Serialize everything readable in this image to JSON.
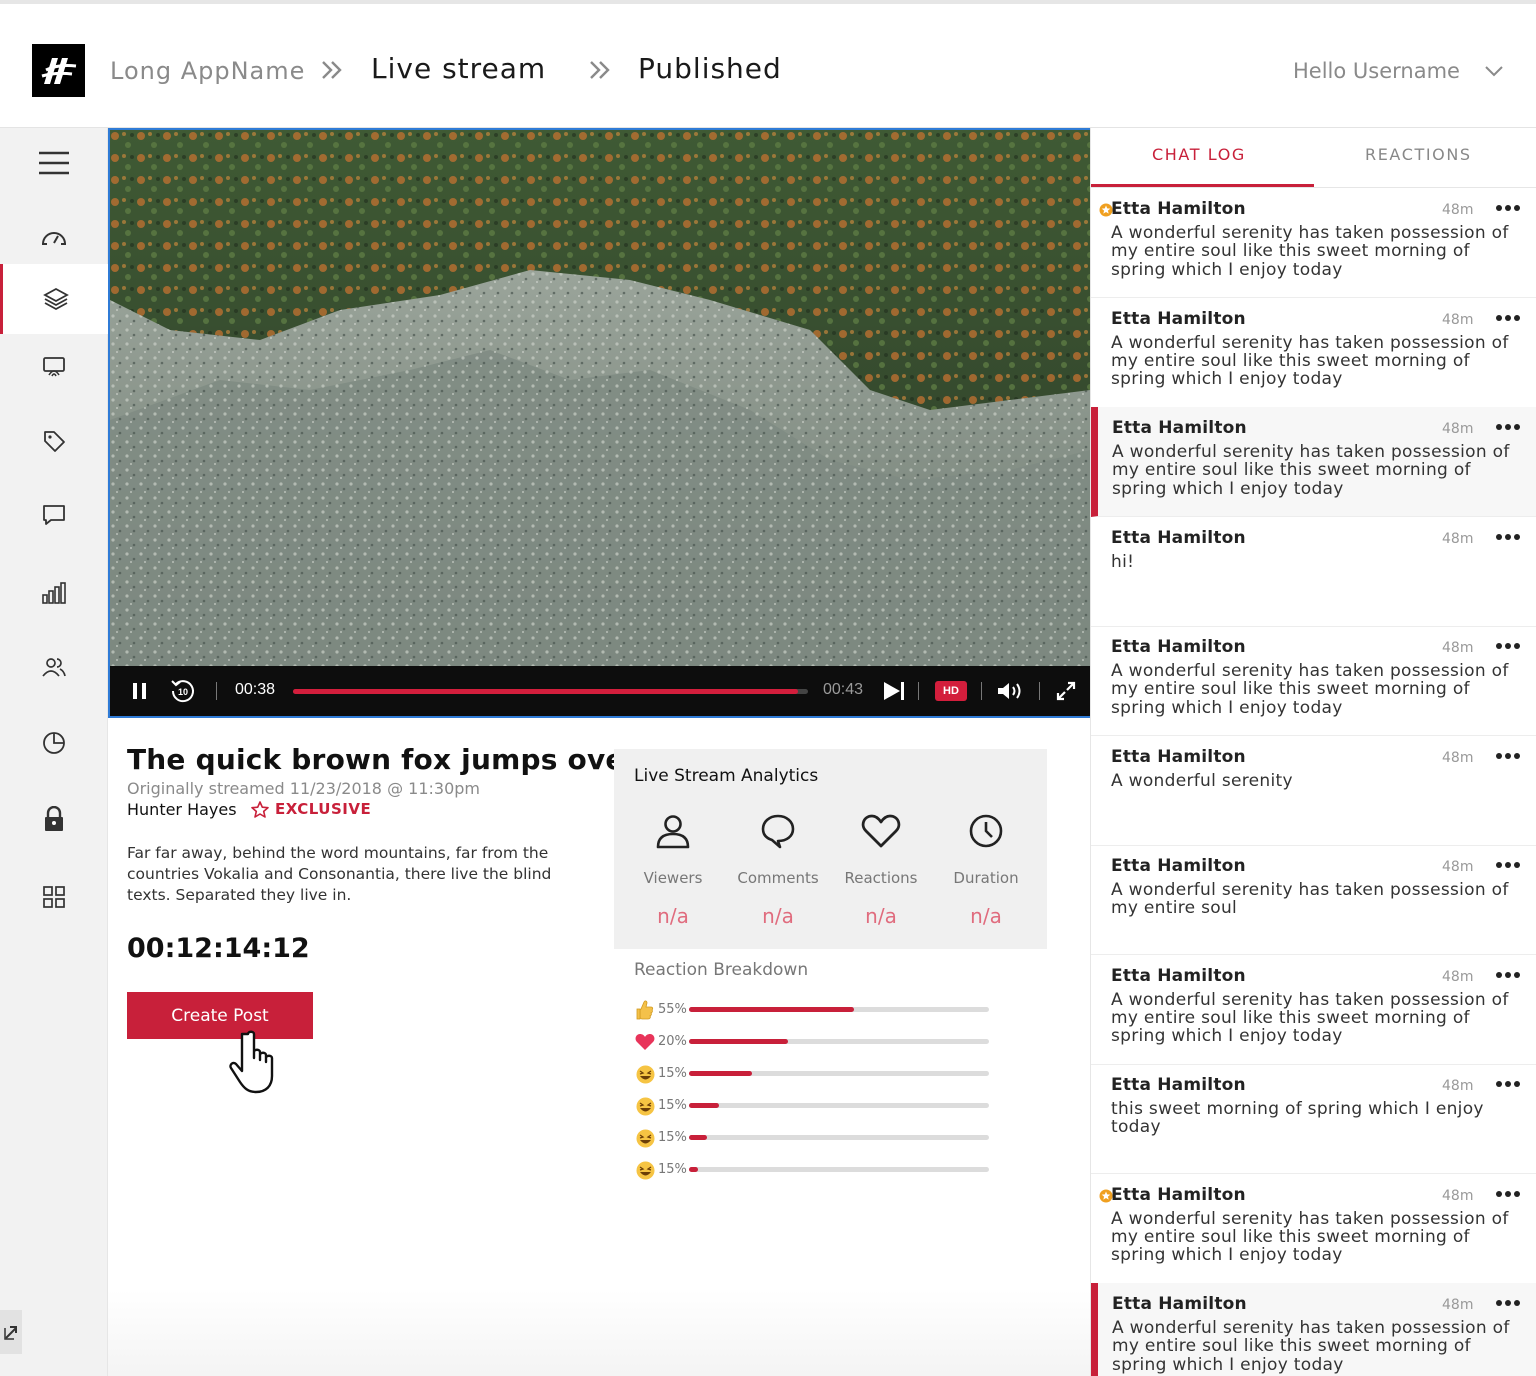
{
  "header": {
    "app_name": "Long AppName",
    "crumb_live": "Live stream",
    "crumb_published": "Published",
    "user_greeting": "Hello Username"
  },
  "sidebar": {
    "items": [
      {
        "icon": "hamburger-menu-icon"
      },
      {
        "icon": "dashboard-gauge-icon"
      },
      {
        "icon": "layers-icon",
        "active": true
      },
      {
        "icon": "cast-icon"
      },
      {
        "icon": "tag-icon"
      },
      {
        "icon": "chat-bubble-icon"
      },
      {
        "icon": "bar-chart-icon"
      },
      {
        "icon": "users-icon"
      },
      {
        "icon": "pie-chart-icon"
      },
      {
        "icon": "lock-icon"
      },
      {
        "icon": "grid-icon"
      }
    ]
  },
  "player": {
    "current_time": "00:38",
    "total_time": "00:43",
    "progress_fraction": 0.98,
    "quality": "HD"
  },
  "post": {
    "title": "The quick brown fox jumps over",
    "subtitle": "Originally streamed 11/23/2018 @ 11:30pm",
    "author": "Hunter Hayes",
    "badge": "EXCLUSIVE",
    "description": "Far far away, behind the word mountains, far from the countries Vokalia and Consonantia, there live the blind texts. Separated they live in.",
    "timer": "00:12:14:12",
    "create_button": "Create Post"
  },
  "analytics": {
    "title": "Live Stream Analytics",
    "metrics": [
      {
        "label": "Viewers",
        "value": "n/a",
        "icon": "person-icon"
      },
      {
        "label": "Comments",
        "value": "n/a",
        "icon": "comment-icon"
      },
      {
        "label": "Reactions",
        "value": "n/a",
        "icon": "heart-icon"
      },
      {
        "label": "Duration",
        "value": "n/a",
        "icon": "clock-icon"
      }
    ]
  },
  "reaction_breakdown": {
    "title": "Reaction Breakdown",
    "rows": [
      {
        "emoji": "thumbs-up-icon",
        "pct": "55%",
        "fill": 0.55
      },
      {
        "emoji": "heart-icon",
        "pct": "20%",
        "fill": 0.33
      },
      {
        "emoji": "laughing-face-icon",
        "pct": "15%",
        "fill": 0.21
      },
      {
        "emoji": "laughing-face-icon",
        "pct": "15%",
        "fill": 0.1
      },
      {
        "emoji": "laughing-face-icon",
        "pct": "15%",
        "fill": 0.06
      },
      {
        "emoji": "laughing-face-icon",
        "pct": "15%",
        "fill": 0.03
      }
    ]
  },
  "chat": {
    "tab_chat": "CHAT LOG",
    "tab_reactions": "REACTIONS",
    "messages": [
      {
        "name": "Etta Hamilton",
        "time": "48m",
        "text": "A wonderful serenity has taken possession of my entire soul like this sweet morning of spring which I enjoy today",
        "starred": true,
        "highlight": false
      },
      {
        "name": "Etta Hamilton",
        "time": "48m",
        "text": "A wonderful serenity has taken possession of my entire soul like this sweet morning of spring which I enjoy today",
        "starred": false,
        "highlight": false
      },
      {
        "name": "Etta Hamilton",
        "time": "48m",
        "text": "A wonderful serenity has taken possession of my entire soul like this sweet morning of spring which I enjoy today",
        "starred": false,
        "highlight": true
      },
      {
        "name": "Etta Hamilton",
        "time": "48m",
        "text": "hi!",
        "starred": false,
        "highlight": false
      },
      {
        "name": "Etta Hamilton",
        "time": "48m",
        "text": "A wonderful serenity has taken possession of my entire soul like this sweet morning of spring which I enjoy today",
        "starred": false,
        "highlight": false
      },
      {
        "name": "Etta Hamilton",
        "time": "48m",
        "text": "A wonderful serenity",
        "starred": false,
        "highlight": false
      },
      {
        "name": "Etta Hamilton",
        "time": "48m",
        "text": "A wonderful serenity has taken possession of my entire soul",
        "starred": false,
        "highlight": false
      },
      {
        "name": "Etta Hamilton",
        "time": "48m",
        "text": "A wonderful serenity has taken possession of my entire soul like this sweet morning of spring which I enjoy today",
        "starred": false,
        "highlight": false
      },
      {
        "name": "Etta Hamilton",
        "time": "48m",
        "text": "this sweet morning of spring which I enjoy today",
        "starred": false,
        "highlight": false
      },
      {
        "name": "Etta Hamilton",
        "time": "48m",
        "text": "A wonderful serenity has taken possession of my entire soul like this sweet morning of spring which I enjoy today",
        "starred": true,
        "highlight": false
      },
      {
        "name": "Etta Hamilton",
        "time": "48m",
        "text": "A wonderful serenity has taken possession of my entire soul like this sweet morning of spring which I enjoy today",
        "starred": false,
        "highlight": true
      }
    ]
  },
  "colors": {
    "accent": "#c8203a",
    "star": "#f0a020",
    "player_border": "#2f7bd6"
  }
}
